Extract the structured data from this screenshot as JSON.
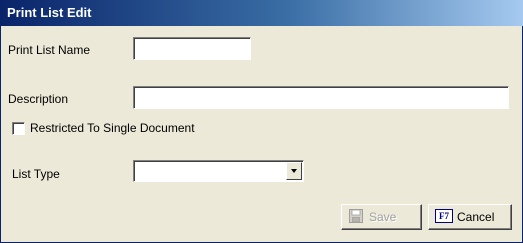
{
  "window": {
    "title": "Print List Edit"
  },
  "form": {
    "print_list_name_label": "Print List Name",
    "print_list_name_value": "",
    "description_label": "Description",
    "description_value": "",
    "restricted_label": "Restricted To Single Document",
    "restricted_checked": false,
    "list_type_label": "List Type",
    "list_type_value": ""
  },
  "buttons": {
    "save_label": "Save",
    "save_enabled": false,
    "cancel_label": "Cancel",
    "cancel_hotkey": "F7"
  },
  "colors": {
    "title_gradient_start": "#0a246a",
    "title_gradient_end": "#a6caf0",
    "face": "#ece9d8"
  }
}
